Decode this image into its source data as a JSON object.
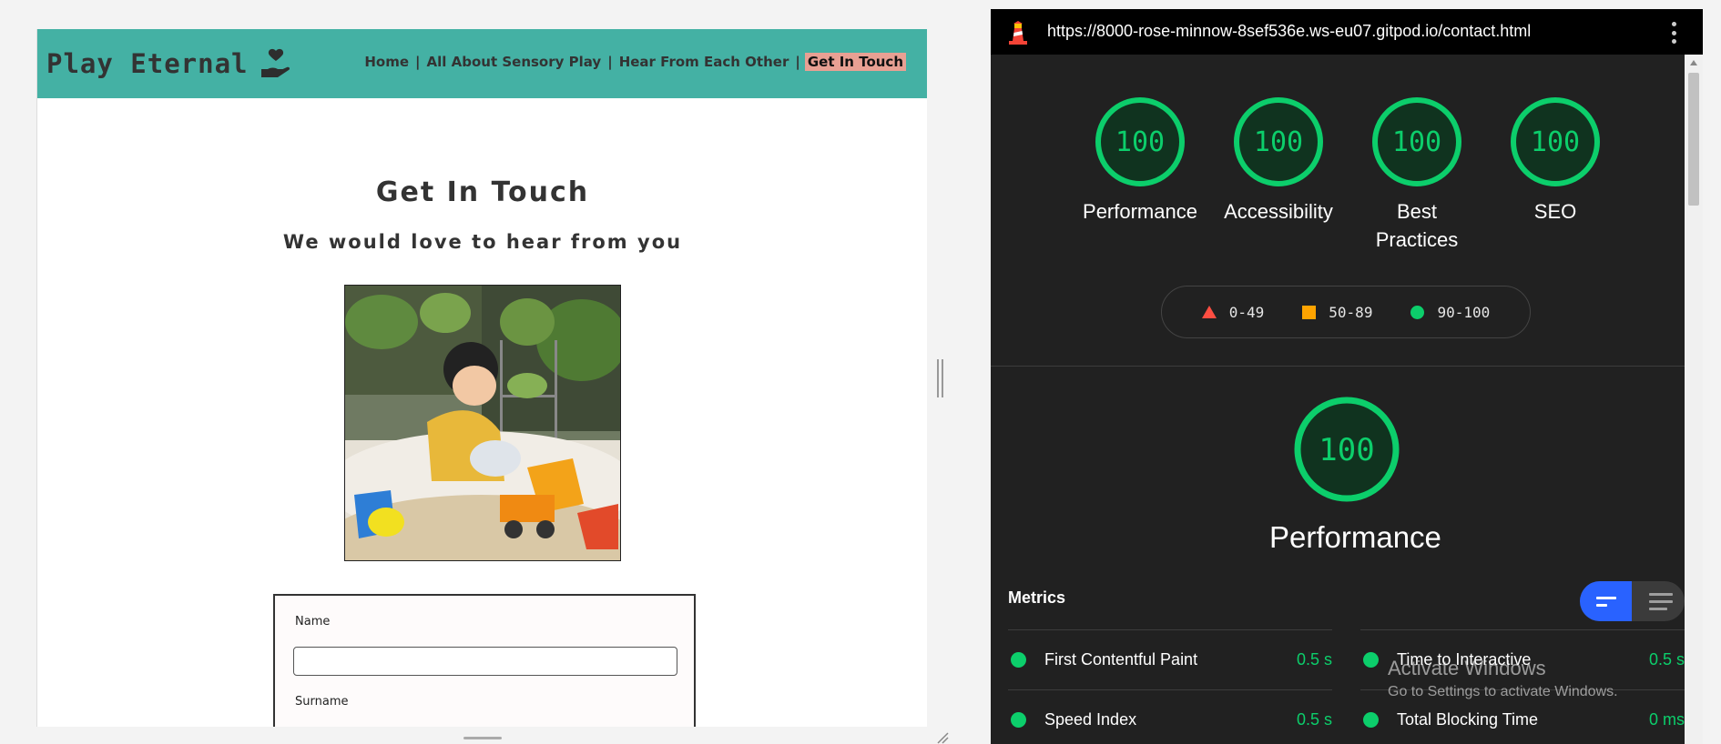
{
  "site": {
    "brand": "Play Eternal",
    "nav": [
      {
        "label": "Home",
        "active": false
      },
      {
        "label": "All About Sensory Play",
        "active": false
      },
      {
        "label": "Hear From Each Other",
        "active": false
      },
      {
        "label": "Get In Touch",
        "active": true
      }
    ],
    "nav_separator": "|",
    "title": "Get In Touch",
    "subtitle": "We would love to hear from you",
    "form": {
      "name_label": "Name",
      "name_value": "",
      "surname_label": "Surname",
      "surname_value": ""
    },
    "colors": {
      "header": "#44b1a4",
      "active_nav": "#e8a093"
    }
  },
  "lighthouse": {
    "url": "https://8000-rose-minnow-8sef536e.ws-eu07.gitpod.io/contact.html",
    "scores": [
      {
        "label": "Performance",
        "value": "100"
      },
      {
        "label": "Accessibility",
        "value": "100"
      },
      {
        "label": "Best Practices",
        "value": "100"
      },
      {
        "label": "SEO",
        "value": "100"
      }
    ],
    "legend": {
      "fail": "0-49",
      "average": "50-89",
      "pass": "90-100"
    },
    "focus": {
      "value": "100",
      "label": "Performance"
    },
    "metrics_title": "Metrics",
    "metrics": [
      {
        "label": "First Contentful Paint",
        "value": "0.5 s"
      },
      {
        "label": "Time to Interactive",
        "value": "0.5 s"
      },
      {
        "label": "Speed Index",
        "value": "0.5 s"
      },
      {
        "label": "Total Blocking Time",
        "value": "0 ms"
      }
    ],
    "colors": {
      "pass": "#0cce6b",
      "average": "#ffa400",
      "fail": "#ff4e42",
      "toggle_active": "#2962ff"
    }
  },
  "watermark": {
    "line1": "Activate Windows",
    "line2": "Go to Settings to activate Windows."
  }
}
